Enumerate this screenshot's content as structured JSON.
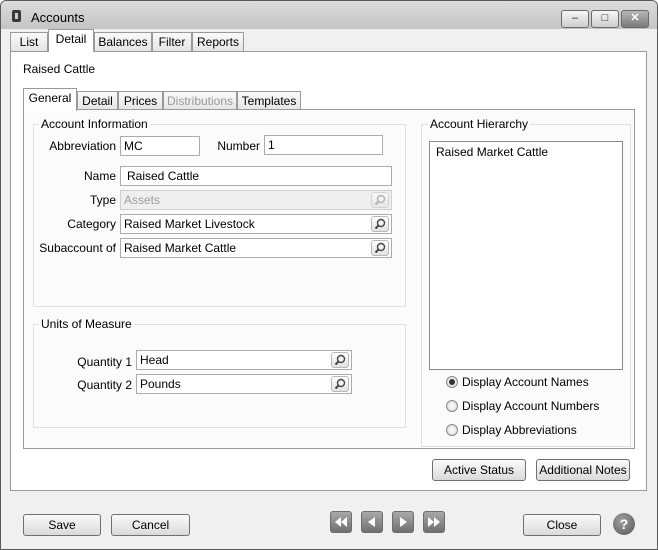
{
  "window": {
    "title": "Accounts"
  },
  "main_tabs": [
    {
      "label": "List"
    },
    {
      "label": "Detail"
    },
    {
      "label": "Balances"
    },
    {
      "label": "Filter"
    },
    {
      "label": "Reports"
    }
  ],
  "record_title": "Raised  Cattle",
  "sub_tabs": [
    {
      "label": "General"
    },
    {
      "label": "Detail"
    },
    {
      "label": "Prices"
    },
    {
      "label": "Distributions"
    },
    {
      "label": "Templates"
    }
  ],
  "account_info": {
    "group_label": "Account Information",
    "abbreviation_label": "Abbreviation",
    "abbreviation_value": "MC",
    "number_label": "Number",
    "number_value": "1",
    "name_label": "Name",
    "name_value": "Raised  Cattle",
    "type_label": "Type",
    "type_value": "Assets",
    "category_label": "Category",
    "category_value": "Raised Market Livestock",
    "subaccount_label": "Subaccount of",
    "subaccount_value": "Raised Market Cattle"
  },
  "units": {
    "group_label": "Units of Measure",
    "qty1_label": "Quantity 1",
    "qty1_value": "Head",
    "qty2_label": "Quantity 2",
    "qty2_value": "Pounds"
  },
  "hierarchy": {
    "group_label": "Account Hierarchy",
    "items": [
      "Raised Market Cattle"
    ],
    "options": [
      {
        "label": "Display Account Names",
        "checked": true
      },
      {
        "label": "Display Account Numbers",
        "checked": false
      },
      {
        "label": "Display Abbreviations",
        "checked": false
      }
    ]
  },
  "buttons": {
    "active_status": "Active Status",
    "additional_notes": "Additional Notes",
    "save": "Save",
    "cancel": "Cancel",
    "close": "Close",
    "help": "?"
  },
  "icons": {
    "lookup": "magnifier-icon",
    "nav_first": "first-record-icon",
    "nav_prev": "previous-record-icon",
    "nav_next": "next-record-icon",
    "nav_last": "last-record-icon",
    "help": "help-icon"
  }
}
